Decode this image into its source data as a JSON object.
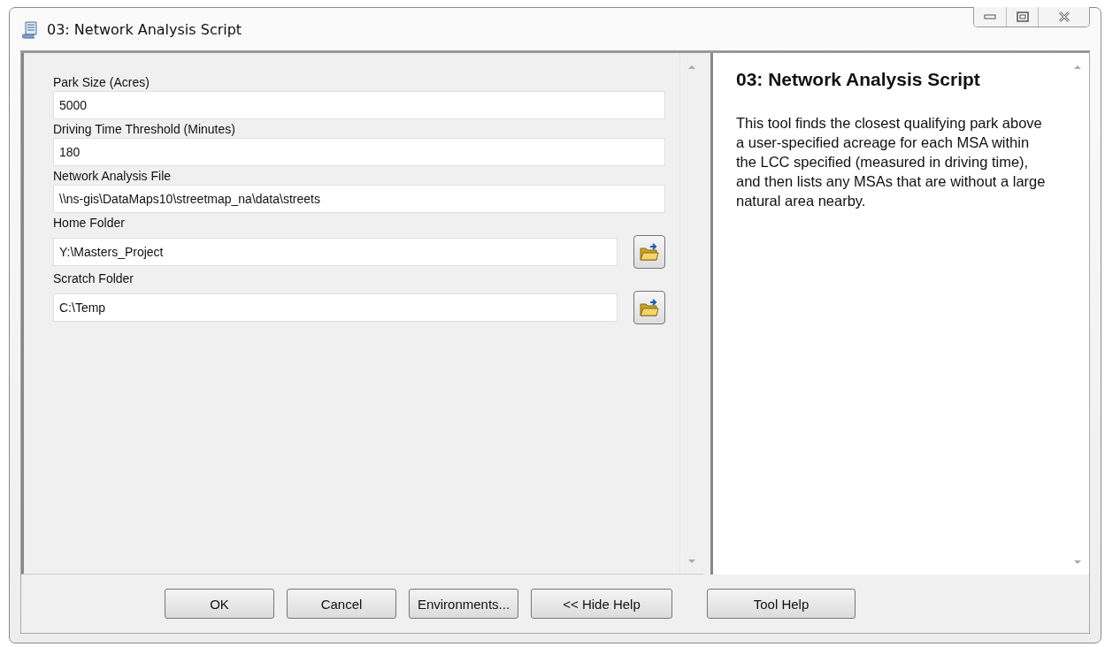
{
  "window": {
    "title": "03: Network Analysis Script"
  },
  "parameters": [
    {
      "label": "Park Size (Acres)",
      "value": "5000",
      "kind": "text"
    },
    {
      "label": "Driving Time Threshold (Minutes)",
      "value": "180",
      "kind": "text"
    },
    {
      "label": "Network Analysis File",
      "value": "\\\\ns-gis\\DataMaps10\\streetmap_na\\data\\streets",
      "kind": "text"
    },
    {
      "label": "Home Folder",
      "value": "Y:\\Masters_Project",
      "kind": "folder"
    },
    {
      "label": "Scratch Folder",
      "value": "C:\\Temp",
      "kind": "folder"
    }
  ],
  "help": {
    "title": "03: Network Analysis Script",
    "text": "This tool finds the closest qualifying park above a user-specified acreage for each MSA within the LCC specified (measured in driving time), and then lists any MSAs that are without a large natural area nearby."
  },
  "buttons": [
    "OK",
    "Cancel",
    "Environments...",
    "<< Hide Help",
    "Tool Help"
  ]
}
